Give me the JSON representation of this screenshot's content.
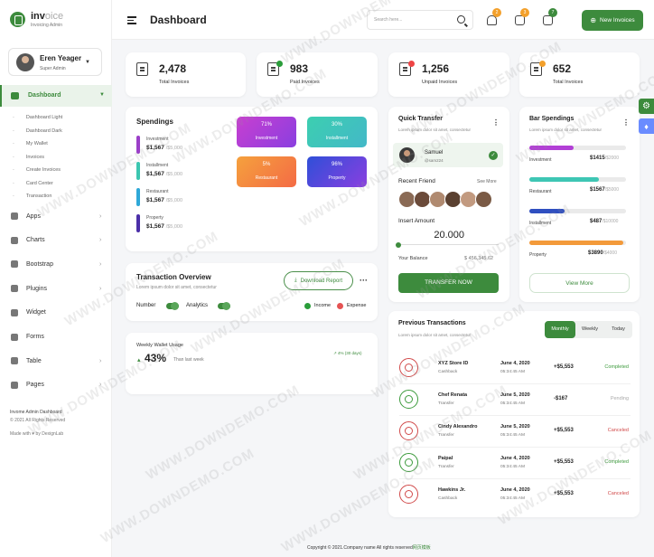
{
  "brand": {
    "name_bold": "inv",
    "name_light": "oice",
    "subtitle": "Invoicing Admin"
  },
  "user": {
    "name": "Eren Yeager",
    "role": "Super Admin"
  },
  "sidebar": {
    "dashboard": "Dashboard",
    "sub_items": [
      "Dashboard Light",
      "Dashboard Dark",
      "My Wallet",
      "Invoices",
      "Create Invoices",
      "Card Center",
      "Transaction"
    ],
    "items": [
      {
        "label": "Apps",
        "icon": "info-icon"
      },
      {
        "label": "Charts",
        "icon": "chart-icon"
      },
      {
        "label": "Bootstrap",
        "icon": "bootstrap-icon"
      },
      {
        "label": "Plugins",
        "icon": "heart-icon"
      },
      {
        "label": "Widget",
        "icon": "users-icon"
      },
      {
        "label": "Forms",
        "icon": "file-icon"
      },
      {
        "label": "Table",
        "icon": "table-icon"
      },
      {
        "label": "Pages",
        "icon": "pages-icon"
      }
    ],
    "footer_title": "Invome Admin Dashboard",
    "footer_copy": "© 2021 All Rights Reserved",
    "footer_made": "Made with",
    "footer_by": "by DexignLab"
  },
  "header": {
    "title": "Dashboard",
    "search_placeholder": "Search here...",
    "new_button": "New Invoices",
    "badges": [
      "2",
      "3",
      "7"
    ]
  },
  "stats": [
    {
      "value": "2,478",
      "label": "Total Invoices",
      "dot": ""
    },
    {
      "value": "983",
      "label": "Paid Invoices",
      "dot": "#2a9d3a"
    },
    {
      "value": "1,256",
      "label": "Unpaid Invoices",
      "dot": "#e44"
    },
    {
      "value": "652",
      "label": "Total Invoices",
      "dot": "#f3a02b"
    }
  ],
  "spendings": {
    "title": "Spendings",
    "items": [
      {
        "name": "Investment",
        "value": "$1,567",
        "total": "/$5,000",
        "color": "#9b3fc8"
      },
      {
        "name": "Installment",
        "value": "$1,567",
        "total": "/$5,000",
        "color": "#3cc6b0"
      },
      {
        "name": "Restaurant",
        "value": "$1,567",
        "total": "/$5,000",
        "color": "#2ea8d8"
      },
      {
        "name": "Property",
        "value": "$1,567",
        "total": "/$5,000",
        "color": "#4b2fa8"
      }
    ],
    "tiles": [
      {
        "percent": "71%",
        "label": "Investment"
      },
      {
        "percent": "30%",
        "label": "Installment"
      },
      {
        "percent": "5%",
        "label": "Restaurant"
      },
      {
        "percent": "96%",
        "label": "Property"
      }
    ]
  },
  "overview": {
    "title": "Transaction Overview",
    "subtitle": "Lorem ipsum dolor sit amet, consectetur",
    "download": "Download Report",
    "toggles": [
      "Number",
      "Analytics"
    ],
    "legend": [
      {
        "label": "Income",
        "color": "#2a9d3a"
      },
      {
        "label": "Expense",
        "color": "#e55353"
      }
    ]
  },
  "weekly": {
    "title": "Weekly Wallet Usage",
    "percent": "43%",
    "compare": "Than last week",
    "trend": "4% (30 days)"
  },
  "quick_transfer": {
    "title": "Quick Transfer",
    "subtitle": "Lorem ipsum dolor sit amet, consectetur",
    "contact_name": "Samuel",
    "contact_handle": "@sam224",
    "recent_label": "Recent Friend",
    "see_more": "See More",
    "amount_label": "Insert Amount",
    "amount": "20.000",
    "balance_label": "Your Balance",
    "balance": "$ 456,345.62",
    "button": "TRANSFER NOW"
  },
  "bar_spendings": {
    "title": "Bar Spendings",
    "subtitle": "Lorem ipsum dolor sit amet, consectetur",
    "items": [
      {
        "name": "Investment",
        "value": "$1415",
        "total": "/$2000",
        "fill": 0.46,
        "color": "#b23fd6"
      },
      {
        "name": "Restaurant",
        "value": "$1567",
        "total": "/$5000",
        "fill": 0.72,
        "color": "#3ec6b4"
      },
      {
        "name": "Installment",
        "value": "$487",
        "total": "/$10000",
        "fill": 0.36,
        "color": "#2f4fc0"
      },
      {
        "name": "Property",
        "value": "$3890",
        "total": "/$4000",
        "fill": 0.97,
        "color": "#f39a3a"
      }
    ],
    "button": "View More"
  },
  "previous": {
    "title": "Previous Transactions",
    "subtitle": "Lorem ipsum dolor sit amet, consectetur",
    "tabs": [
      "Monthly",
      "Weekly",
      "Today"
    ],
    "rows": [
      {
        "name": "XYZ Store ID",
        "type": "Cashback",
        "date": "June 4, 2020",
        "time": "05:34:45 AM",
        "amount": "+$5,553",
        "status": "Completed",
        "status_color": "#3d9b3d",
        "icon_color": "#d14a4a"
      },
      {
        "name": "Chef Renata",
        "type": "Transfer",
        "date": "June 5, 2020",
        "time": "05:34:45 AM",
        "amount": "-$167",
        "status": "Pending",
        "status_color": "#aaa",
        "icon_color": "#3d9b3d"
      },
      {
        "name": "Cindy Alexandro",
        "type": "Transfer",
        "date": "June 5, 2020",
        "time": "05:34:45 AM",
        "amount": "+$5,553",
        "status": "Canceled",
        "status_color": "#d14a4a",
        "icon_color": "#d14a4a"
      },
      {
        "name": "Paipal",
        "type": "Transfer",
        "date": "June 4, 2020",
        "time": "05:34:45 AM",
        "amount": "+$5,553",
        "status": "Completed",
        "status_color": "#3d9b3d",
        "icon_color": "#3d9b3d"
      },
      {
        "name": "Hawkins Jr.",
        "type": "Cashback",
        "date": "June 4, 2020",
        "time": "05:34:45 AM",
        "amount": "+$5,553",
        "status": "Canceled",
        "status_color": "#d14a4a",
        "icon_color": "#d14a4a"
      }
    ]
  },
  "footer": {
    "text": "Copyright © 2021.Company name All rights reserved",
    "link": "网页模板"
  },
  "watermark": "WWW.DOWNDEMO.COM",
  "colors": {
    "accent": "#3d8b3d"
  }
}
